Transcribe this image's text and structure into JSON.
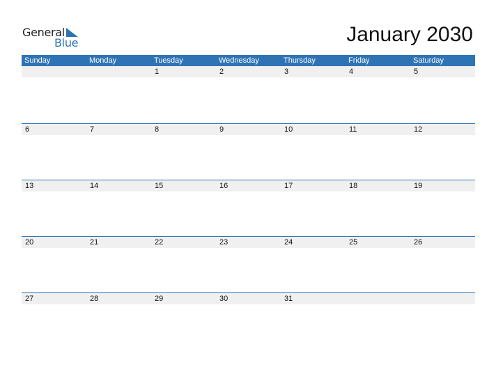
{
  "logo": {
    "word1": "General",
    "word2": "Blue",
    "accent_color": "#2e74b5"
  },
  "title": "January 2030",
  "weekdays": [
    "Sunday",
    "Monday",
    "Tuesday",
    "Wednesday",
    "Thursday",
    "Friday",
    "Saturday"
  ],
  "weeks": [
    [
      "",
      "",
      "1",
      "2",
      "3",
      "4",
      "5"
    ],
    [
      "6",
      "7",
      "8",
      "9",
      "10",
      "11",
      "12"
    ],
    [
      "13",
      "14",
      "15",
      "16",
      "17",
      "18",
      "19"
    ],
    [
      "20",
      "21",
      "22",
      "23",
      "24",
      "25",
      "26"
    ],
    [
      "27",
      "28",
      "29",
      "30",
      "31",
      "",
      ""
    ]
  ],
  "colors": {
    "header_bg": "#2e74b5",
    "date_strip_bg": "#f0f0f0"
  }
}
